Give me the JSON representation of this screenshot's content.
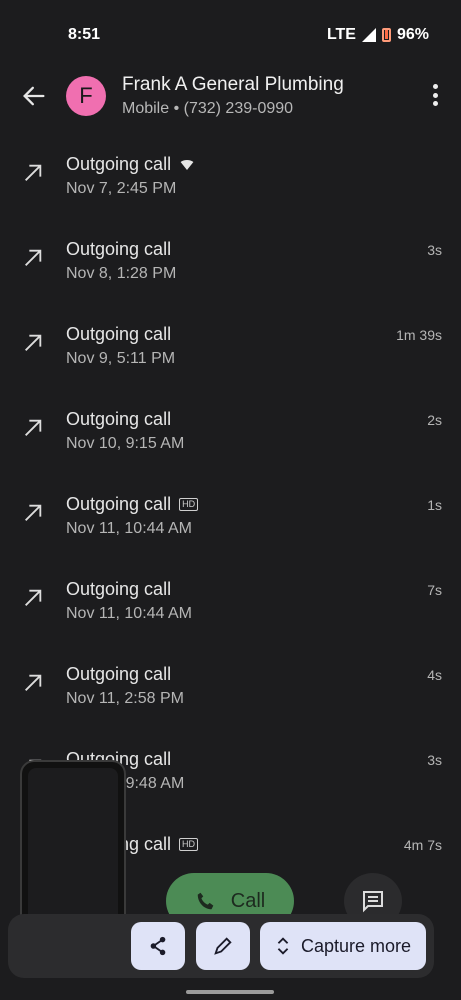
{
  "status": {
    "time": "8:51",
    "network": "LTE",
    "battery": "96%"
  },
  "contact": {
    "initial": "F",
    "name": "Frank A General Plumbing",
    "subtitle": "Mobile • (732) 239-0990",
    "avatar_color": "#f06fb0"
  },
  "calls": [
    {
      "type": "Outgoing call",
      "date": "Nov 7, 2:45 PM",
      "duration": "",
      "badge": "wifi"
    },
    {
      "type": "Outgoing call",
      "date": "Nov 8, 1:28 PM",
      "duration": "3s",
      "badge": ""
    },
    {
      "type": "Outgoing call",
      "date": "Nov 9, 5:11 PM",
      "duration": "1m 39s",
      "badge": ""
    },
    {
      "type": "Outgoing call",
      "date": "Nov 10, 9:15 AM",
      "duration": "2s",
      "badge": ""
    },
    {
      "type": "Outgoing call",
      "date": "Nov 11, 10:44 AM",
      "duration": "1s",
      "badge": "HD"
    },
    {
      "type": "Outgoing call",
      "date": "Nov 11, 10:44 AM",
      "duration": "7s",
      "badge": ""
    },
    {
      "type": "Outgoing call",
      "date": "Nov 11, 2:58 PM",
      "duration": "4s",
      "badge": ""
    },
    {
      "type": "Outgoing call",
      "date": "Nov 12, 9:48 AM",
      "duration": "3s",
      "badge": ""
    },
    {
      "type": "Incoming call",
      "date": "",
      "duration": "4m 7s",
      "badge": "HD"
    }
  ],
  "actions": {
    "call_label": "Call"
  },
  "capture": {
    "capture_more_label": "Capture more"
  },
  "colors": {
    "call_button": "#4c8b55",
    "tool_button": "#dfe3f7"
  }
}
